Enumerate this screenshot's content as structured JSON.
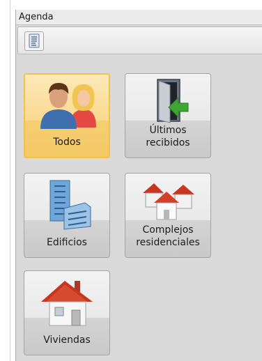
{
  "panel": {
    "title": "Agenda"
  },
  "toolbar": {
    "button_icon": "document-list-icon"
  },
  "tiles": [
    {
      "label": "Todos",
      "icon": "people-icon",
      "selected": true
    },
    {
      "label": "Últimos\nrecibidos",
      "icon": "door-arrow-icon",
      "selected": false
    },
    {
      "label": "Edificios",
      "icon": "buildings-icon",
      "selected": false
    },
    {
      "label": "Complejos\nresidenciales",
      "icon": "houses-icon",
      "selected": false
    },
    {
      "label": "Viviendas",
      "icon": "house-icon",
      "selected": false
    }
  ],
  "colors": {
    "selected_border": "#f3c24a",
    "selected_fill": "#fad98f",
    "roof": "#c8361f",
    "arrow": "#3fa535"
  }
}
